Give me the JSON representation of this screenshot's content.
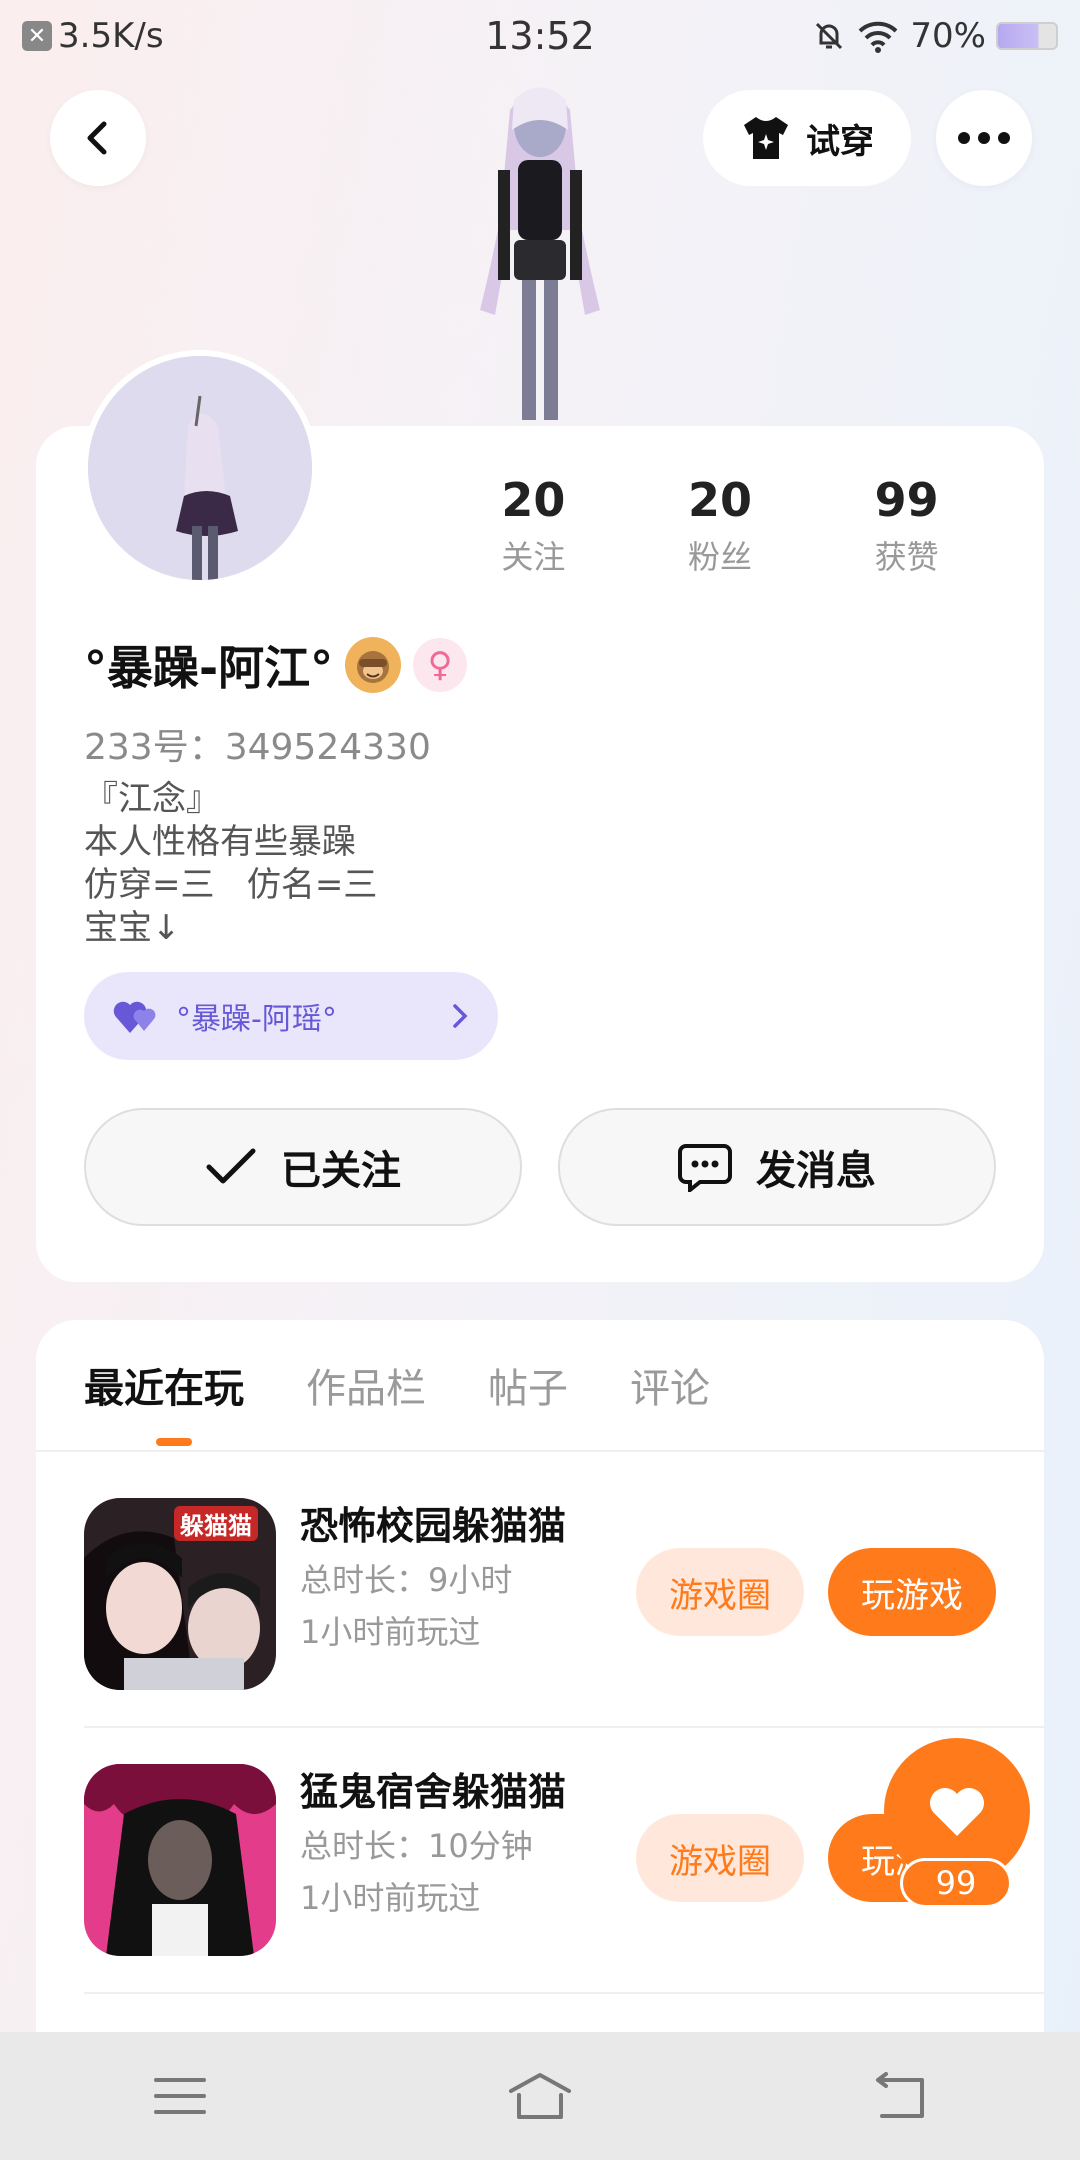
{
  "status_bar": {
    "net_speed": "3.5K/s",
    "time": "13:52",
    "battery": "70%"
  },
  "header": {
    "try_on_label": "试穿"
  },
  "profile": {
    "stats": [
      {
        "value": "20",
        "label": "关注"
      },
      {
        "value": "20",
        "label": "粉丝"
      },
      {
        "value": "99",
        "label": "获赞"
      }
    ],
    "nickname": "°暴躁-阿江°",
    "uid": "233号：349524330",
    "bio": [
      "『江念』",
      "本人性格有些暴躁",
      "仿穿=三   仿名=三",
      "宝宝↓"
    ],
    "couple_name": "°暴躁-阿瑶°",
    "follow_label": "已关注",
    "message_label": "发消息"
  },
  "tabs": [
    "最近在玩",
    "作品栏",
    "帖子",
    "评论"
  ],
  "games": [
    {
      "title": "恐怖校园躲猫猫",
      "duration": "总时长：9小时",
      "last_played": "1小时前玩过",
      "circle_label": "游戏圈",
      "play_label": "玩游戏",
      "thumb_text": "躲猫猫"
    },
    {
      "title": "猛鬼宿舍躲猫猫",
      "duration": "总时长：10分钟",
      "last_played": "1小时前玩过",
      "circle_label": "游戏圈",
      "play_label": "玩游戏"
    }
  ],
  "like_count": "99",
  "colors": {
    "accent": "#ff7a1a",
    "couple": "#6658d6"
  }
}
